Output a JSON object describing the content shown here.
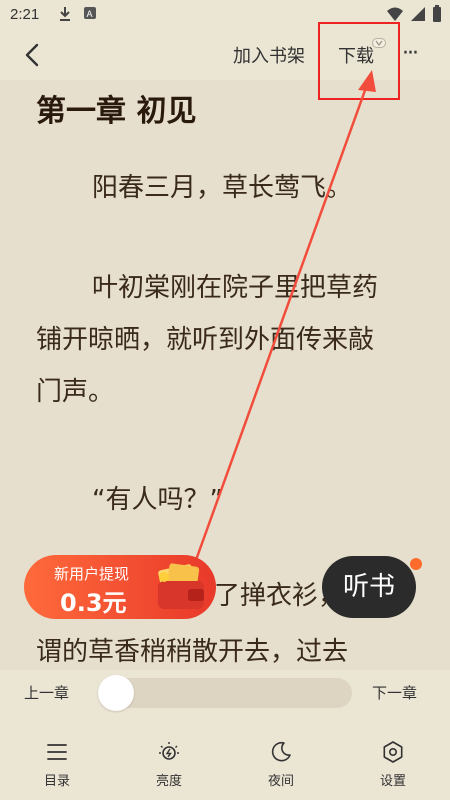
{
  "status": {
    "time": "2:21"
  },
  "toolbar": {
    "add_shelf": "加入书架",
    "download": "下载",
    "more": "···"
  },
  "chapter": {
    "title": "第一章 初见"
  },
  "paragraphs": [
    "阳春三月，草长莺飞。",
    "叶初棠刚在院子里把草药",
    "铺开晾晒，就听到外面传来敲",
    "门声。",
    "“有人吗？”",
    "了掸衣衫，前去",
    "谓的草香稍稍散开去，过去"
  ],
  "promo": {
    "line1": "新用户提现",
    "line2": "0.3元"
  },
  "listen": {
    "label": "听书"
  },
  "progress": {
    "prev": "上一章",
    "next": "下一章",
    "position": 0.0
  },
  "nav": [
    {
      "label": "目录",
      "icon": "list-icon"
    },
    {
      "label": "亮度",
      "icon": "brightness-icon"
    },
    {
      "label": "夜间",
      "icon": "moon-icon"
    },
    {
      "label": "设置",
      "icon": "settings-icon"
    }
  ],
  "colors": {
    "accent": "#e22222",
    "promo": "#ff6a3b",
    "background": "#e6dfcd"
  }
}
